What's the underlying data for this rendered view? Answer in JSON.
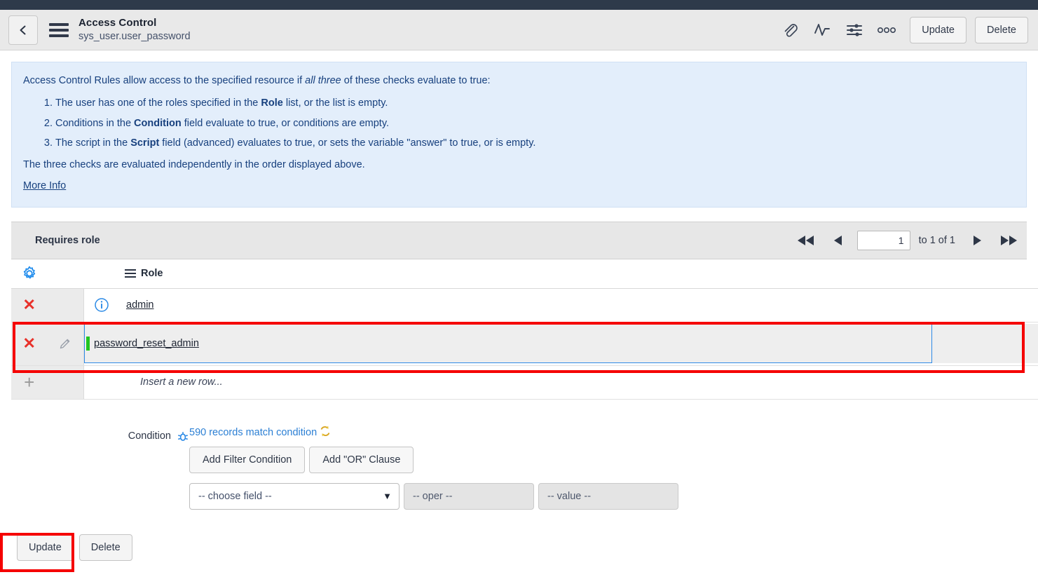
{
  "header": {
    "back_icon": "chevron-left-icon",
    "menu_icon": "hamburger-menu-icon",
    "title": "Access Control",
    "subtitle": "sys_user.user_password",
    "icons": [
      {
        "name": "attachment-icon",
        "glyph": "paperclip"
      },
      {
        "name": "activity-icon",
        "glyph": "pulse"
      },
      {
        "name": "personalize-form-icon",
        "glyph": "sliders"
      },
      {
        "name": "more-options-icon",
        "glyph": "ooo"
      }
    ],
    "update_label": "Update",
    "delete_label": "Delete"
  },
  "banner": {
    "intro_pre": "Access Control Rules allow access to the specified resource if ",
    "intro_em": "all three",
    "intro_post": " of these checks evaluate to true:",
    "items": [
      {
        "pre": "The user has one of the roles specified in the ",
        "bold": "Role",
        "post": " list, or the list is empty."
      },
      {
        "pre": "Conditions in the ",
        "bold": "Condition",
        "post": " field evaluate to true, or conditions are empty."
      },
      {
        "pre": "The script in the ",
        "bold": "Script",
        "post": " field (advanced) evaluates to true, or sets the variable \"answer\" to true, or is empty."
      }
    ],
    "closing": "The three checks are evaluated independently in the order displayed above.",
    "more_info": "More Info"
  },
  "related_list": {
    "title": "Requires role",
    "pager": {
      "first_icon": "first-page-icon",
      "prev_icon": "previous-page-icon",
      "page_value": "1",
      "range_label": "to 1 of 1",
      "next_icon": "next-page-icon",
      "last_icon": "last-page-icon"
    },
    "gear_icon": "list-settings-gear-icon",
    "column_header": "Role",
    "rows": [
      {
        "delete_icon": "delete-row-icon",
        "info_icon": "info-icon",
        "value": "admin",
        "editing": false
      },
      {
        "delete_icon": "delete-row-icon",
        "edit_icon": "edit-pencil-icon",
        "value": "password_reset_admin",
        "editing": true
      }
    ],
    "insert_row": {
      "plus_icon": "add-row-icon",
      "label": "Insert a new row..."
    }
  },
  "condition": {
    "label": "Condition",
    "debug_icon": "condition-debug-icon",
    "records_match": "590 records match condition",
    "refresh_icon": "refresh-records-icon",
    "add_filter_label": "Add Filter Condition",
    "add_or_label": "Add \"OR\" Clause",
    "field_select": "-- choose field --",
    "oper_select": "-- oper --",
    "value_select": "-- value --"
  },
  "footer": {
    "update_label": "Update",
    "delete_label": "Delete"
  },
  "colors": {
    "accent_blue": "#2b7fd4",
    "icon_blue": "#1f8ced",
    "annotation_red": "#f50000",
    "marker_green": "#21c521",
    "delete_red": "#e8312a",
    "banner_bg": "#e3eefb",
    "banner_text": "#17407e",
    "topbar": "#2e3a4a"
  }
}
